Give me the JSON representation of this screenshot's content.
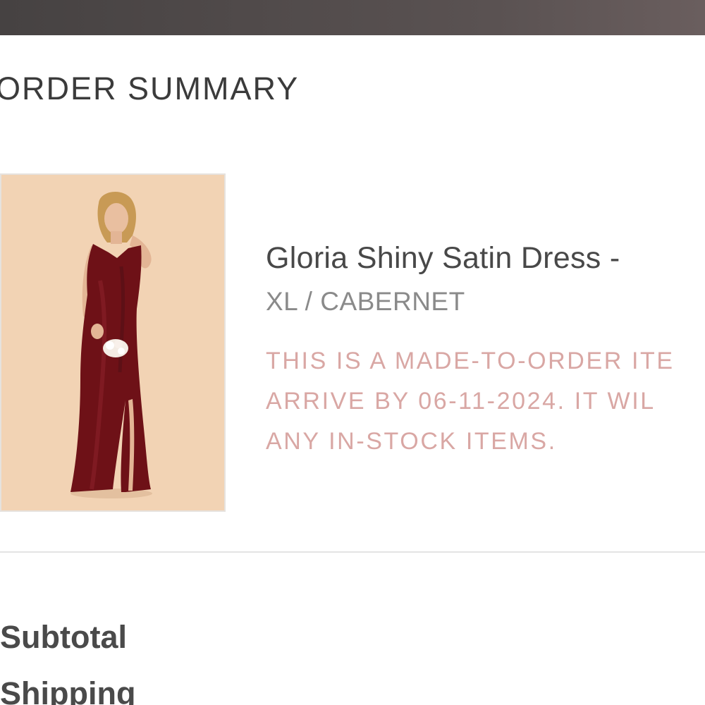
{
  "header": {
    "bar_color": "#4a4646"
  },
  "order_summary": {
    "title": "ORDER SUMMARY"
  },
  "item": {
    "name": "Gloria Shiny Satin Dress -",
    "variant": "XL / CABERNET",
    "notice_lines": [
      "THIS IS A MADE-TO-ORDER ITE",
      "ARRIVE BY 06-11-2024. IT WIL",
      "ANY IN-STOCK ITEMS."
    ],
    "image_icon": "dress-photo",
    "dress_color": "#6e1117",
    "image_background": "#f2d3b4"
  },
  "totals": {
    "subtotal_label": "Subtotal",
    "shipping_label": "Shipping"
  },
  "colors": {
    "title_text": "#3b3b3b",
    "notice_text": "#d9a7a4",
    "variant_text": "#8a8a8a"
  }
}
